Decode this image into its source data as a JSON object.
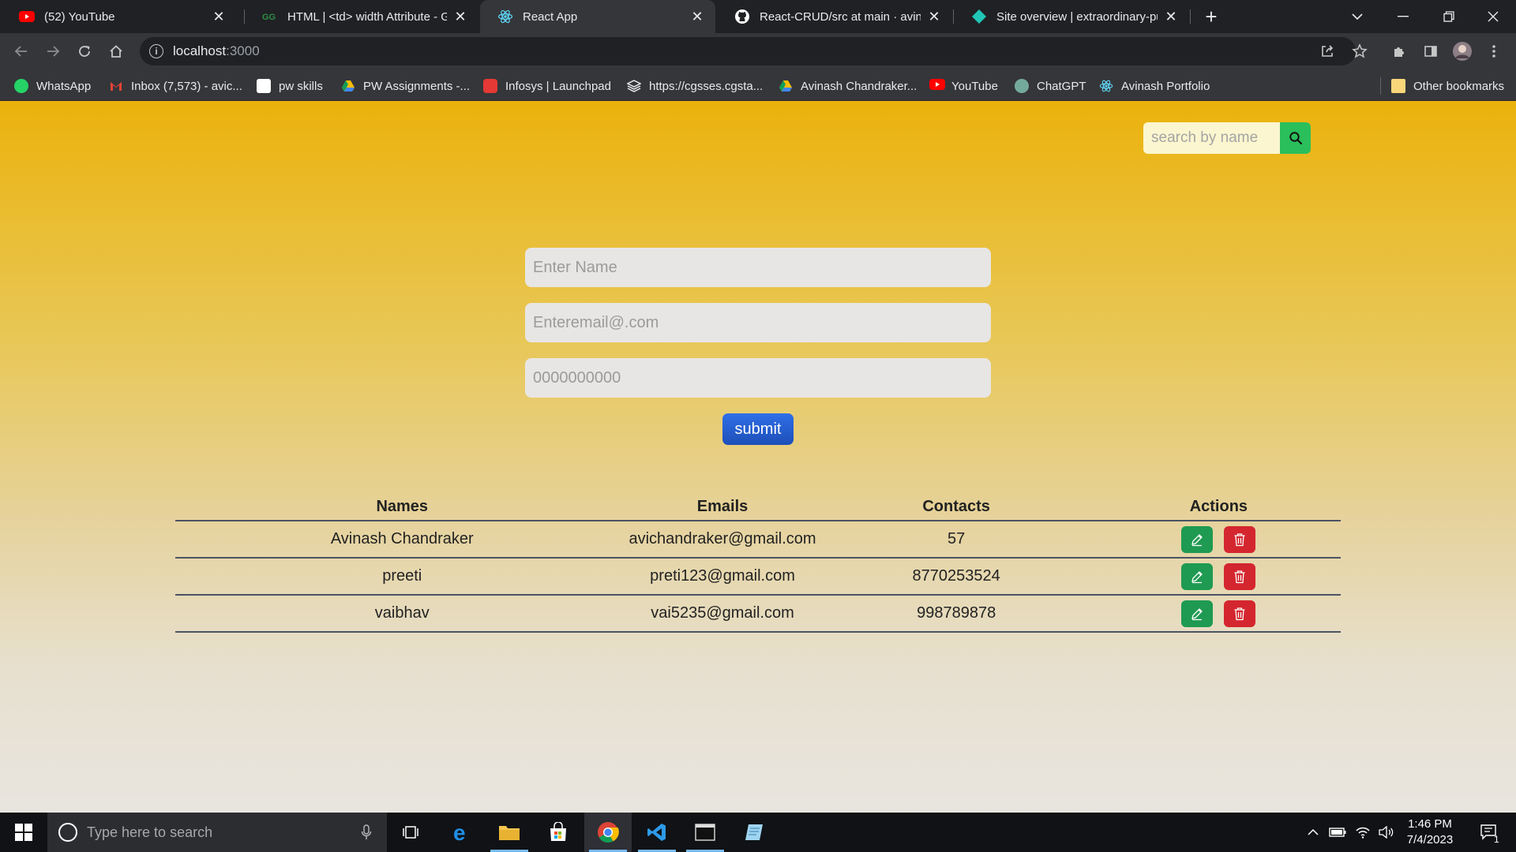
{
  "browser": {
    "tabs": [
      {
        "title": "(52) YouTube",
        "active": false,
        "icon": "youtube-icon"
      },
      {
        "title": "HTML | <td> width Attribute - Ge",
        "active": false,
        "icon": "geeksforgeeks-icon"
      },
      {
        "title": "React App",
        "active": true,
        "icon": "react-icon"
      },
      {
        "title": "React-CRUD/src at main · avinash",
        "active": false,
        "icon": "github-icon"
      },
      {
        "title": "Site overview | extraordinary-puff",
        "active": false,
        "icon": "netlify-icon"
      }
    ],
    "address": {
      "host": "localhost",
      "port": ":3000"
    },
    "bookmarks": [
      {
        "label": "WhatsApp",
        "icon": "whatsapp-icon",
        "color": "#25d366"
      },
      {
        "label": "Inbox (7,573) - avic...",
        "icon": "gmail-icon",
        "color": "#ea4335"
      },
      {
        "label": "pw skills",
        "icon": "pwskills-icon",
        "color": "#ffffff"
      },
      {
        "label": "PW Assignments -...",
        "icon": "google-drive-icon",
        "color": "#fbbc04"
      },
      {
        "label": "Infosys | Launchpad",
        "icon": "infosys-icon",
        "color": "#e53935"
      },
      {
        "label": "https://cgsses.cgsta...",
        "icon": "stack-icon",
        "color": "#e8eaed"
      },
      {
        "label": "Avinash Chandraker...",
        "icon": "google-drive-icon",
        "color": "#fbbc04"
      },
      {
        "label": "YouTube",
        "icon": "youtube-icon",
        "color": "#ff0000"
      },
      {
        "label": "ChatGPT",
        "icon": "chatgpt-icon",
        "color": "#74aa9c"
      },
      {
        "label": "Avinash Portfolio",
        "icon": "react-icon",
        "color": "#61dafb"
      }
    ],
    "other_bookmarks": "Other bookmarks"
  },
  "page": {
    "search": {
      "placeholder": "search by name"
    },
    "form": {
      "name_placeholder": "Enter Name",
      "email_placeholder": "Enteremail@.com",
      "contact_placeholder": "0000000000",
      "submit_label": "submit"
    },
    "table": {
      "headers": {
        "names": "Names",
        "emails": "Emails",
        "contacts": "Contacts",
        "actions": "Actions"
      },
      "rows": [
        {
          "name": "Avinash Chandraker",
          "email": "avichandraker@gmail.com",
          "contact": "57"
        },
        {
          "name": "preeti",
          "email": "preti123@gmail.com",
          "contact": "8770253524"
        },
        {
          "name": "vaibhav",
          "email": "vai5235@gmail.com",
          "contact": "998789878"
        }
      ]
    },
    "colors": {
      "edit": "#1f9a52",
      "delete": "#d4262e",
      "submit": "#2563d8",
      "search_button": "#2bbf5b"
    }
  },
  "taskbar": {
    "search_placeholder": "Type here to search",
    "time": "1:46 PM",
    "date": "7/4/2023",
    "notification_count": "1"
  }
}
